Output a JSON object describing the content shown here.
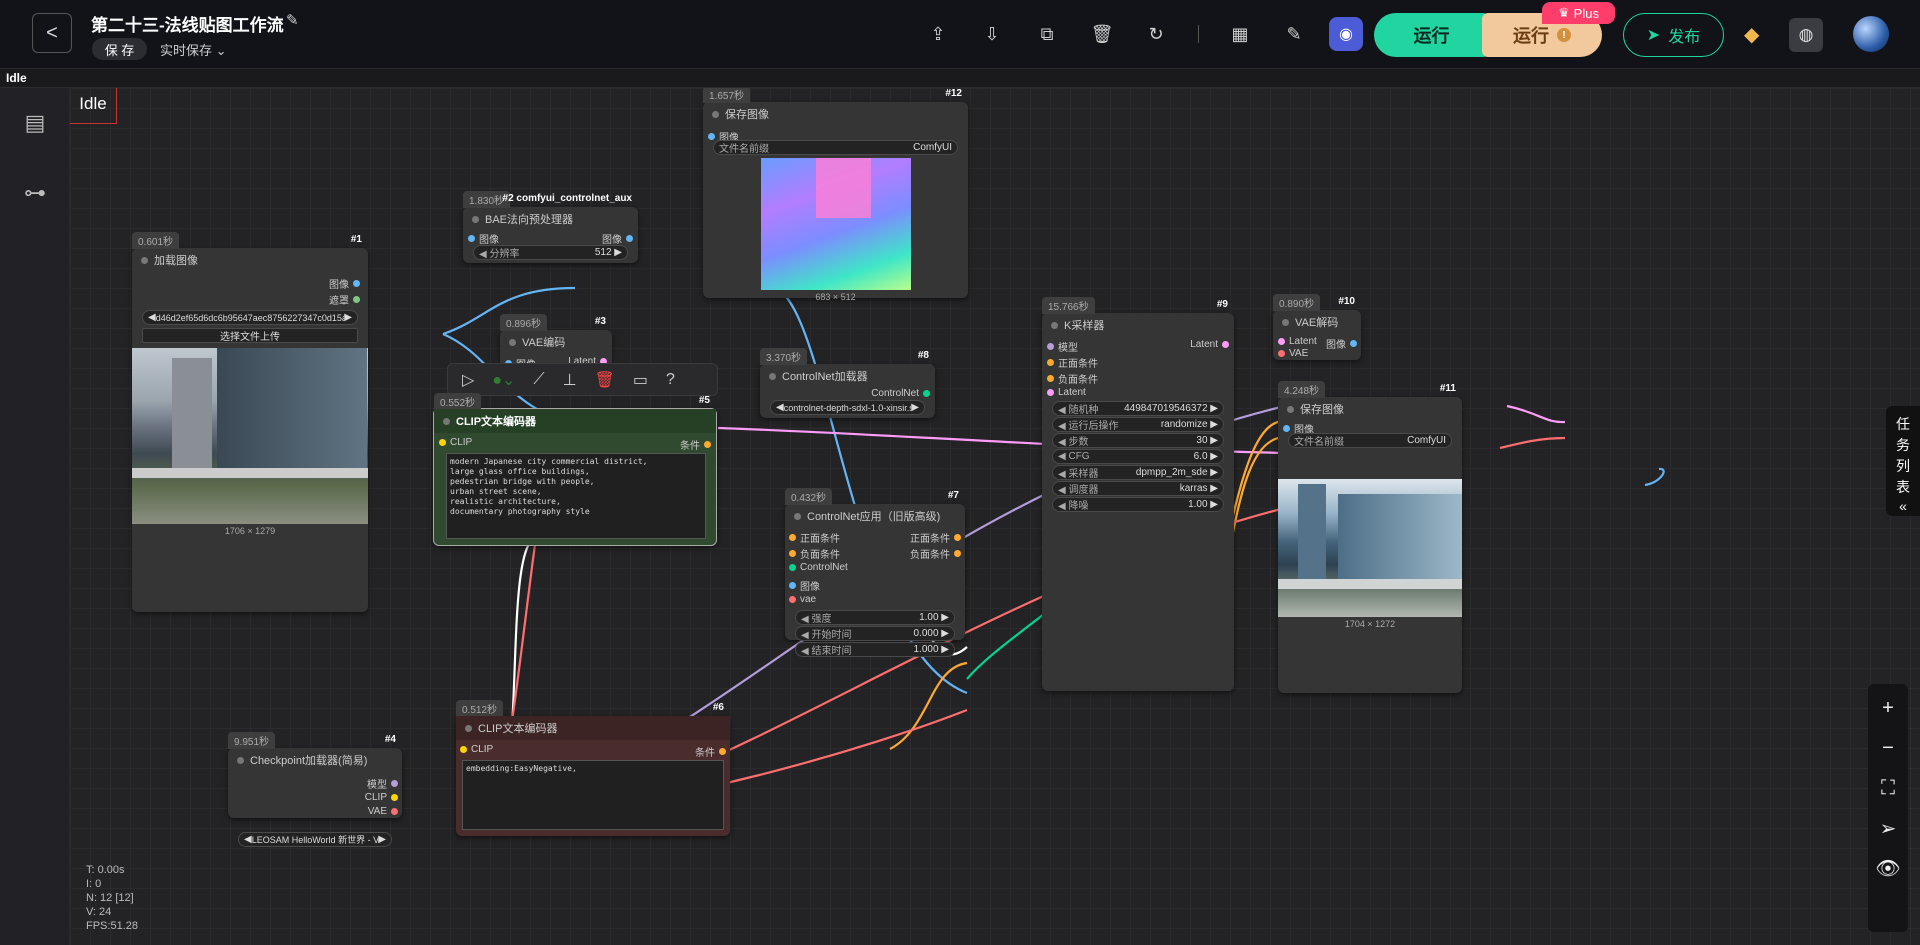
{
  "topbar": {
    "back": "<",
    "title": "第二十三-法线贴图工作流",
    "edit_icon": "✎",
    "save_label": "保 存",
    "autosave_label": "实时保存 ",
    "run_label": "运行",
    "run2_label": "运行",
    "plus_badge": "Plus",
    "publish_label": "发布"
  },
  "status_bar": {
    "text": "Idle"
  },
  "canvas": {
    "idle_label": "Idle"
  },
  "stats": {
    "t": "T: 0.00s",
    "i": "I: 0",
    "n": "N: 12 [12]",
    "v": "V: 24",
    "fps": "FPS:51.28"
  },
  "task_list": {
    "label": [
      "任",
      "务",
      "列",
      "表"
    ]
  },
  "nodes": {
    "load_image": {
      "time": "0.601秒",
      "id": "#1",
      "title": "加载图像",
      "out_image": "图像",
      "out_mask": "遮罩",
      "file": "d46d2ef65d6dc6b95647aec8756227347c0d15a0d...",
      "upload": "选择文件上传",
      "caption": "1706 × 1279"
    },
    "bae": {
      "time": "1.830秒",
      "id": "#2 comfyui_controlnet_aux",
      "title": "BAE法向预处理器",
      "in_image": "图像",
      "out_image": "图像",
      "res_label": "分辨率",
      "res_value": "512"
    },
    "vae_encode": {
      "time": "0.896秒",
      "id": "#3",
      "title": "VAE编码",
      "in_image": "图像",
      "in_vae": "VAE",
      "out_latent": "Latent"
    },
    "save1": {
      "time": "1.657秒",
      "id": "#12",
      "title": "保存图像",
      "in_image": "图像",
      "prefix_label": "文件名前缀",
      "prefix_value": "ComfyUI",
      "caption": "683 × 512"
    },
    "clip_pos": {
      "time": "0.552秒",
      "id": "#5",
      "title": "CLIP文本编码器",
      "in_clip": "CLIP",
      "out_cond": "条件",
      "text": "modern Japanese city commercial district,\nlarge glass office buildings,\npedestrian bridge with people,\nurban street scene,\nrealistic architecture,\ndocumentary photography style"
    },
    "controlnet_loader": {
      "time": "3.370秒",
      "id": "#8",
      "title": "ControlNet加载器",
      "out": "ControlNet",
      "model": "controlnet-depth-sdxl-1.0-xinsir.s ..."
    },
    "ksampler": {
      "time": "15.766秒",
      "id": "#9",
      "title": "K采样器",
      "in_model": "模型",
      "in_pos": "正面条件",
      "in_neg": "负面条件",
      "in_latent": "Latent",
      "out_latent": "Latent",
      "widgets": [
        {
          "label": "随机种",
          "value": "449847019546372"
        },
        {
          "label": "运行后操作",
          "value": "randomize"
        },
        {
          "label": "步数",
          "value": "30"
        },
        {
          "label": "CFG",
          "value": "6.0"
        },
        {
          "label": "采样器",
          "value": "dpmpp_2m_sde"
        },
        {
          "label": "调度器",
          "value": "karras"
        },
        {
          "label": "降噪",
          "value": "1.00"
        }
      ]
    },
    "vae_decode": {
      "time": "0.890秒",
      "id": "#10",
      "title": "VAE解码",
      "in_latent": "Latent",
      "in_vae": "VAE",
      "out_image": "图像"
    },
    "save2": {
      "time": "4.248秒",
      "id": "#11",
      "title": "保存图像",
      "in_image": "图像",
      "prefix_label": "文件名前缀",
      "prefix_value": "ComfyUI",
      "caption": "1704 × 1272"
    },
    "controlnet_apply": {
      "time": "0.432秒",
      "id": "#7",
      "title": "ControlNet应用（旧版高级)",
      "in_pos": "正面条件",
      "in_neg": "负面条件",
      "in_cn": "ControlNet",
      "in_image": "图像",
      "in_vae": "vae",
      "out_pos": "正面条件",
      "out_neg": "负面条件",
      "widgets": [
        {
          "label": "强度",
          "value": "1.00"
        },
        {
          "label": "开始时间",
          "value": "0.000"
        },
        {
          "label": "结束时间",
          "value": "1.000"
        }
      ]
    },
    "clip_neg": {
      "time": "0.512秒",
      "id": "#6",
      "title": "CLIP文本编码器",
      "in_clip": "CLIP",
      "out_cond": "条件",
      "text": "embedding:EasyNegative,"
    },
    "checkpoint": {
      "time": "9.951秒",
      "id": "#4",
      "title": "Checkpoint加载器(简易)",
      "out_model": "模型",
      "out_clip": "CLIP",
      "out_vae": "VAE",
      "model": "LEOSAM HelloWorld 新世界 - V ..."
    }
  },
  "colors": {
    "accent": "#20d5a0",
    "run2": "#f2c99c",
    "plus": "#ff3d6b",
    "wire_image": "#64b5f6",
    "wire_latent": "#ff9cf9",
    "wire_cond": "#ffa931",
    "wire_vae": "#ff6e6e",
    "wire_clip": "#ffd500",
    "wire_model": "#b39ddb",
    "wire_cn": "#00d78d",
    "clip_pos_bg": "#2f4a2f",
    "clip_neg_bg": "#4a2c2c"
  }
}
